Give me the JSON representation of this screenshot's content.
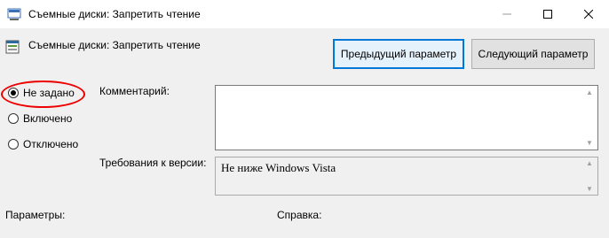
{
  "window": {
    "title": "Съемные диски: Запретить чтение",
    "icons": {
      "app": "policy-window-icon",
      "minimize": "minimize-icon",
      "maximize": "maximize-icon",
      "close": "close-icon"
    }
  },
  "header": {
    "policy_name": "Съемные диски: Запретить чтение",
    "policy_icon": "policy-settings-icon",
    "prev_button": "Предыдущий параметр",
    "next_button": "Следующий параметр"
  },
  "state": {
    "options": [
      "Не задано",
      "Включено",
      "Отключено"
    ],
    "selected": "Не задано",
    "highlight_color": "#e00000"
  },
  "comment": {
    "label": "Комментарий:",
    "value": ""
  },
  "requirements": {
    "label": "Требования к версии:",
    "value": "Не ниже Windows Vista"
  },
  "sections": {
    "parameters": "Параметры:",
    "help": "Справка:"
  },
  "colors": {
    "accent": "#0078d7"
  }
}
